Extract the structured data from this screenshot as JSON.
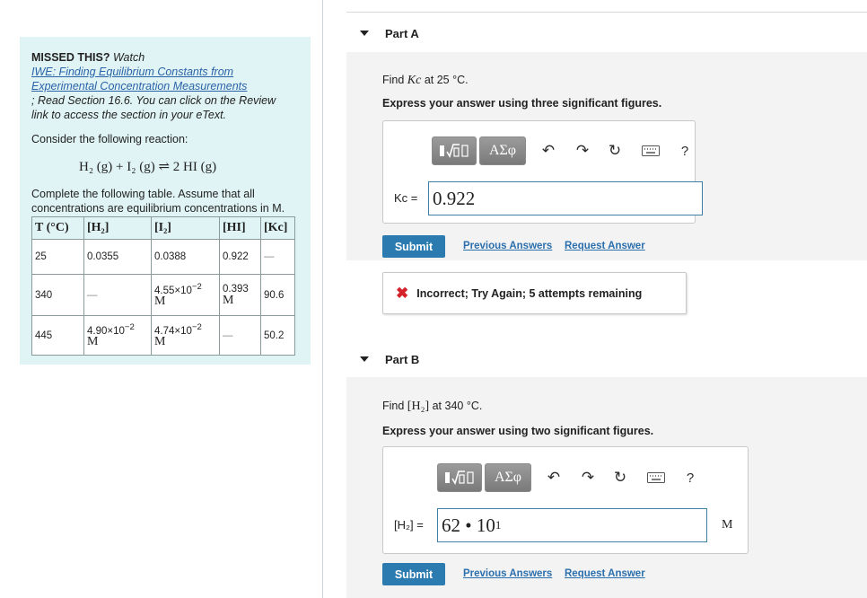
{
  "sidebar": {
    "missed_label": "MISSED THIS?",
    "watch_label": " Watch",
    "video_link": "IWE: Finding Equilibrium Constants from Experimental Concentration Measurements",
    "read_text": "; Read Section 16.6. You can click on the Review link to access the section in your eText.",
    "consider": "Consider the following reaction:",
    "reaction": "H₂ (g) + I₂ (g) ⇌ 2 HI (g)",
    "complete": "Complete the following table. Assume that all concentrations are equilibrium concentrations in M.",
    "table": {
      "headers": [
        "T (°C)",
        "[H₂]",
        "[I₂]",
        "[HI]",
        "[Kc]"
      ],
      "rows": [
        {
          "t": "25",
          "h2": "0.0355",
          "i2": "0.0388",
          "hi": "0.922",
          "kc": "—"
        },
        {
          "t": "340",
          "h2": "—",
          "i2_base": "4.55×10",
          "i2_exp": "−2",
          "i2_unit": "M",
          "hi_line1": "0.393",
          "hi_line2": "M",
          "kc": "90.6"
        },
        {
          "t": "445",
          "h2_base": "4.90×10",
          "h2_exp": "−2",
          "h2_unit": "M",
          "i2_base": "4.74×10",
          "i2_exp": "−2",
          "i2_unit": "M",
          "hi": "—",
          "kc": "50.2"
        }
      ]
    }
  },
  "partA": {
    "title": "Part A",
    "find_prefix": "Find ",
    "find_var": "Kc",
    "find_suffix": " at 25 °C.",
    "express": "Express your answer using three significant figures.",
    "toolbar": {
      "greek": "ΑΣφ",
      "help": "?"
    },
    "label": "Kc =",
    "input_value": "0.922",
    "submit": "Submit",
    "previous_answers": "Previous Answers",
    "request_answer": "Request Answer",
    "feedback": "Incorrect; Try Again; 5 attempts remaining"
  },
  "partB": {
    "title": "Part B",
    "find_prefix": "Find ",
    "find_var": "[H₂]",
    "find_suffix": " at 340 °C.",
    "express": "Express your answer using two significant figures.",
    "toolbar": {
      "greek": "ΑΣφ",
      "help": "?"
    },
    "label": "[H₂] =",
    "input_base": "62 • 10",
    "input_exp": "1",
    "unit": "M",
    "submit": "Submit",
    "previous_answers": "Previous Answers",
    "request_answer": "Request Answer"
  },
  "colors": {
    "accent": "#2b7bb1",
    "link": "#2b6fad",
    "info_bg": "#e0f4f5",
    "error": "#d4232a"
  }
}
